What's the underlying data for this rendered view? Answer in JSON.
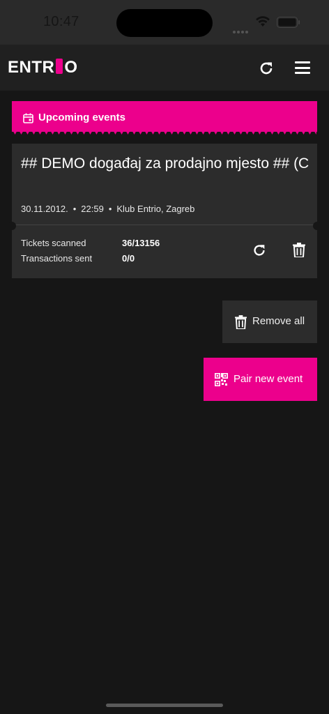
{
  "status_bar": {
    "time": "10:47"
  },
  "header": {
    "logo_left": "ENTR",
    "logo_right": "O",
    "refresh_icon": "refresh-icon",
    "menu_icon": "hamburger-menu-icon"
  },
  "banner": {
    "label": "Upcoming events",
    "icon": "calendar-icon"
  },
  "event": {
    "title": "## DEMO događaj za prodajno mjesto ## (C",
    "date": "30.11.2012.",
    "time": "22:59",
    "venue": "Klub Entrio, Zagreb",
    "tickets_scanned_label": "Tickets scanned",
    "tickets_scanned_value": "36/13156",
    "transactions_sent_label": "Transactions sent",
    "transactions_sent_value": "0/0"
  },
  "actions": {
    "remove_all_label": "Remove all",
    "pair_new_event_label": "Pair new event"
  },
  "colors": {
    "accent": "#ec008c",
    "background": "#161616",
    "card": "#2c2c2c"
  }
}
